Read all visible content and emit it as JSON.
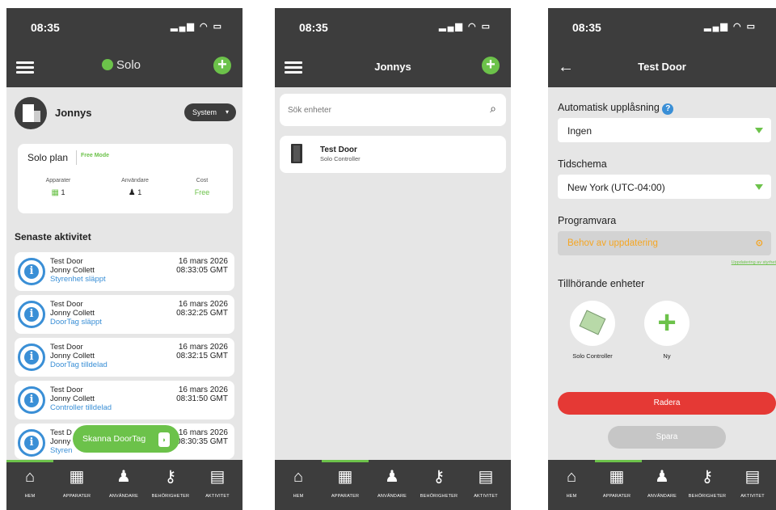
{
  "status_time": "08:35",
  "status_icons": "▂▄▆ ◠ ▭",
  "colors": {
    "brand_green": "#6cc24a",
    "bar_dark": "#3d3d3d",
    "info_blue": "#3a8fd6",
    "danger_red": "#e53935",
    "warning_orange": "#f5a623"
  },
  "bottom_tabs": [
    {
      "label": "HEM",
      "icon": "home-icon"
    },
    {
      "label": "APPARATER",
      "icon": "grid-icon"
    },
    {
      "label": "ANVÄNDARE",
      "icon": "user-icon"
    },
    {
      "label": "BEHÖRIGHETER",
      "icon": "key-icon"
    },
    {
      "label": "AKTIVITET",
      "icon": "calendar-icon"
    }
  ],
  "screen1": {
    "logo_text": "Solo",
    "site_name": "Jonnys",
    "system_button": "System",
    "plan_title": "Solo plan",
    "plan_mode": "Free Mode",
    "stats": [
      {
        "label": "Apparater",
        "value": "1"
      },
      {
        "label": "Användare",
        "value": "1"
      },
      {
        "label": "Cost",
        "value": "Free"
      }
    ],
    "recent_title": "Senaste aktivitet",
    "activities": [
      {
        "device": "Test Door",
        "user": "Jonny Collett",
        "event": "Styrenhet släppt",
        "date": "16 mars 2026",
        "time": "08:33:05 GMT"
      },
      {
        "device": "Test Door",
        "user": "Jonny Collett",
        "event": "DoorTag släppt",
        "date": "16 mars 2026",
        "time": "08:32:25 GMT"
      },
      {
        "device": "Test Door",
        "user": "Jonny Collett",
        "event": "DoorTag tilldelad",
        "date": "16 mars 2026",
        "time": "08:32:15 GMT"
      },
      {
        "device": "Test Door",
        "user": "Jonny Collett",
        "event": "Controller tilldelad",
        "date": "16 mars 2026",
        "time": "08:31:50 GMT"
      },
      {
        "device": "Test D",
        "user": "Jonny",
        "event": "Styren",
        "date": "16 mars 2026",
        "time": "08:30:35 GMT"
      }
    ],
    "scan_button": "Skanna DoorTag"
  },
  "screen2": {
    "title": "Jonnys",
    "search_placeholder": "Sök enheter",
    "devices": [
      {
        "name": "Test Door",
        "type": "Solo Controller"
      }
    ]
  },
  "screen3": {
    "title": "Test Door",
    "auto_unlock_label": "Automatisk upplåsning",
    "auto_unlock_value": "Ingen",
    "schedule_label": "Tidschema",
    "schedule_value": "New York (UTC-04:00)",
    "software_label": "Programvara",
    "software_value": "Behov av uppdatering",
    "software_note": "Uppdatering av styrhet",
    "associated_label": "Tillhörande enheter",
    "associated": [
      {
        "name": "Solo Controller"
      },
      {
        "name": "Ny"
      }
    ],
    "delete_button": "Radera",
    "save_button": "Spara"
  }
}
